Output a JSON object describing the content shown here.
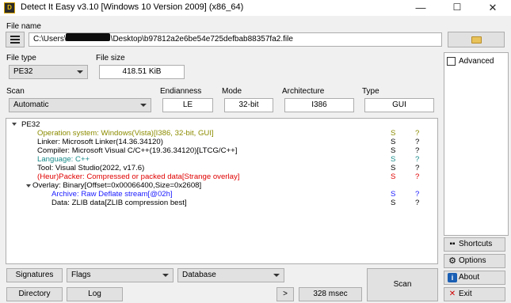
{
  "window": {
    "title": "Detect It Easy v3.10 [Windows 10 Version 2009] (x86_64)",
    "controls": {
      "minimize": "—",
      "maximize": "☐",
      "close": "✕"
    }
  },
  "file_name": {
    "label": "File name",
    "path_prefix": "C:\\Users\\",
    "path_suffix": "\\Desktop\\b97812a2e6be54e725defbab88357fa2.file"
  },
  "file_type": {
    "label": "File type",
    "value": "PE32"
  },
  "file_size": {
    "label": "File size",
    "value": "418.51 KiB"
  },
  "scan": {
    "label": "Scan",
    "mode": "Automatic",
    "endianness_label": "Endianness",
    "endianness": "LE",
    "mode_label": "Mode",
    "bitness": "32-bit",
    "architecture_label": "Architecture",
    "architecture": "I386",
    "type_label": "Type",
    "type": "GUI"
  },
  "results": {
    "root": "PE32",
    "items": [
      {
        "text": "Operation system: Windows(Vista)[I386, 32-bit, GUI]",
        "s": "S",
        "q": "?",
        "color": "#8b8b00",
        "scolor": "#8b8b00",
        "qcolor": "#8b8b00"
      },
      {
        "text": "Linker: Microsoft Linker(14.36.34120)",
        "s": "S",
        "q": "?",
        "color": "#000000",
        "scolor": "#000000",
        "qcolor": "#000000"
      },
      {
        "text": "Compiler: Microsoft Visual C/C++(19.36.34120)[LTCG/C++]",
        "s": "S",
        "q": "?",
        "color": "#000000",
        "scolor": "#000000",
        "qcolor": "#000000"
      },
      {
        "text": "Language: C++",
        "s": "S",
        "q": "?",
        "color": "#1a8a8a",
        "scolor": "#1a8a8a",
        "qcolor": "#1a8a8a"
      },
      {
        "text": "Tool: Visual Studio(2022, v17.6)",
        "s": "S",
        "q": "?",
        "color": "#000000",
        "scolor": "#000000",
        "qcolor": "#000000"
      },
      {
        "text": "(Heur)Packer: Compressed or packed data[Strange overlay]",
        "s": "S",
        "q": "?",
        "color": "#e00000",
        "scolor": "#e00000",
        "qcolor": "#e00000"
      },
      {
        "text": "Overlay: Binary[Offset=0x00066400,Size=0x2608]",
        "s": "",
        "q": "",
        "color": "#000000",
        "scolor": "#000000",
        "qcolor": "#000000"
      },
      {
        "text": "Archive: Raw Deflate stream[@02h]",
        "s": "S",
        "q": "?",
        "color": "#1a1aff",
        "scolor": "#1a1aff",
        "qcolor": "#1a1aff"
      },
      {
        "text": "Data: ZLIB data[ZLIB compression best]",
        "s": "S",
        "q": "?",
        "color": "#000000",
        "scolor": "#000000",
        "qcolor": "#000000"
      }
    ]
  },
  "options": {
    "advanced": "Advanced"
  },
  "side_buttons": {
    "shortcuts": "Shortcuts",
    "options": "Options",
    "about": "About",
    "exit": "Exit"
  },
  "bottom": {
    "signatures": "Signatures",
    "flags": "Flags",
    "database": "Database",
    "directory": "Directory",
    "log": "Log",
    "more": ">",
    "time": "328 msec",
    "scan": "Scan"
  }
}
